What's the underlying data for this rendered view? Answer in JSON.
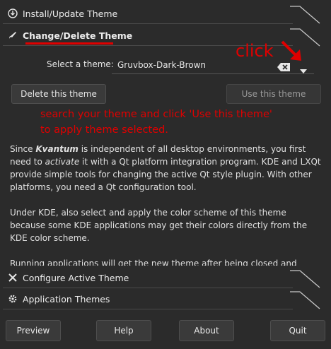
{
  "sections": {
    "install": {
      "label": "Install/Update Theme",
      "icon": "download-icon"
    },
    "change": {
      "label": "Change/Delete Theme",
      "icon": "brush-icon"
    },
    "configure": {
      "label": "Configure Active Theme",
      "icon": "tools-icon"
    },
    "app_themes": {
      "label": "Application Themes",
      "icon": "gear-icon"
    }
  },
  "select_theme": {
    "label": "Select a theme:",
    "value": "Gruvbox-Dark-Brown"
  },
  "buttons": {
    "delete": "Delete this theme",
    "use": "Use this theme"
  },
  "annotation": {
    "click": "click",
    "line1": "search your theme and click 'Use this theme'",
    "line2": "to apply theme selected.",
    "color": "#e00000"
  },
  "description": {
    "p1_since": "Since ",
    "p1_kvantum": "Kvantum",
    "p1_mid": " is independent of all desktop environments, you first need to ",
    "p1_activate": "activate",
    "p1_rest": " it with a Qt platform integration program. KDE and LXQt provide simple tools for changing the active Qt style plugin. With other platforms, you need a Qt configuration tool.",
    "p2": "Under KDE, also select and apply the color scheme of this theme because some KDE applications may get their colors directly from the KDE color scheme.",
    "p3": "Running applications will get the new theme after being closed and"
  },
  "footer": {
    "preview": "Preview",
    "help": "Help",
    "about": "About",
    "quit": "Quit"
  }
}
